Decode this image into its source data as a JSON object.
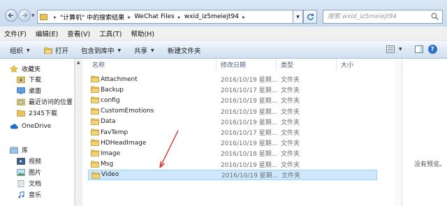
{
  "address": {
    "crumbs": [
      "\"计算机\" 中的搜索结果",
      "WeChat Files",
      "wxid_iz5meiejt94"
    ]
  },
  "search": {
    "placeholder": "搜索 wxid_iz5meiejt94"
  },
  "menu": {
    "items": [
      "文件(F)",
      "编辑(E)",
      "查看(V)",
      "工具(T)",
      "帮助(H)"
    ]
  },
  "toolbar": {
    "organize": "组织",
    "open": "打开",
    "include": "包含到库中",
    "share": "共享",
    "new_folder": "新建文件夹"
  },
  "sidebar": {
    "favorites": {
      "label": "收藏夹",
      "items": [
        "下载",
        "桌面",
        "最近访问的位置",
        "2345下载"
      ]
    },
    "onedrive": "OneDrive",
    "library": {
      "label": "库",
      "items": [
        "视频",
        "图片",
        "文档",
        "音乐"
      ]
    }
  },
  "columns": {
    "name": "名称",
    "date": "修改日期",
    "type": "类型",
    "size": "大小"
  },
  "files": [
    {
      "name": "Attachment",
      "date": "2016/10/19 星期...",
      "type": "文件夹"
    },
    {
      "name": "Backup",
      "date": "2016/10/17 星期...",
      "type": "文件夹"
    },
    {
      "name": "config",
      "date": "2016/10/19 星期...",
      "type": "文件夹"
    },
    {
      "name": "CustomEmotions",
      "date": "2016/10/19 星期...",
      "type": "文件夹"
    },
    {
      "name": "Data",
      "date": "2016/10/19 星期...",
      "type": "文件夹"
    },
    {
      "name": "FavTemp",
      "date": "2016/10/17 星期...",
      "type": "文件夹"
    },
    {
      "name": "HDHeadImage",
      "date": "2016/10/19 星期...",
      "type": "文件夹"
    },
    {
      "name": "Image",
      "date": "2016/10/18 星期...",
      "type": "文件夹"
    },
    {
      "name": "Msg",
      "date": "2016/10/19 星期...",
      "type": "文件夹"
    },
    {
      "name": "Video",
      "date": "2016/10/19 星期...",
      "type": "文件夹",
      "selected": true
    }
  ],
  "preview": {
    "message": "没有预览。"
  },
  "colors": {
    "selection": "#cde8ff",
    "arrow": "#e0302a",
    "folder": "#e6c460"
  }
}
